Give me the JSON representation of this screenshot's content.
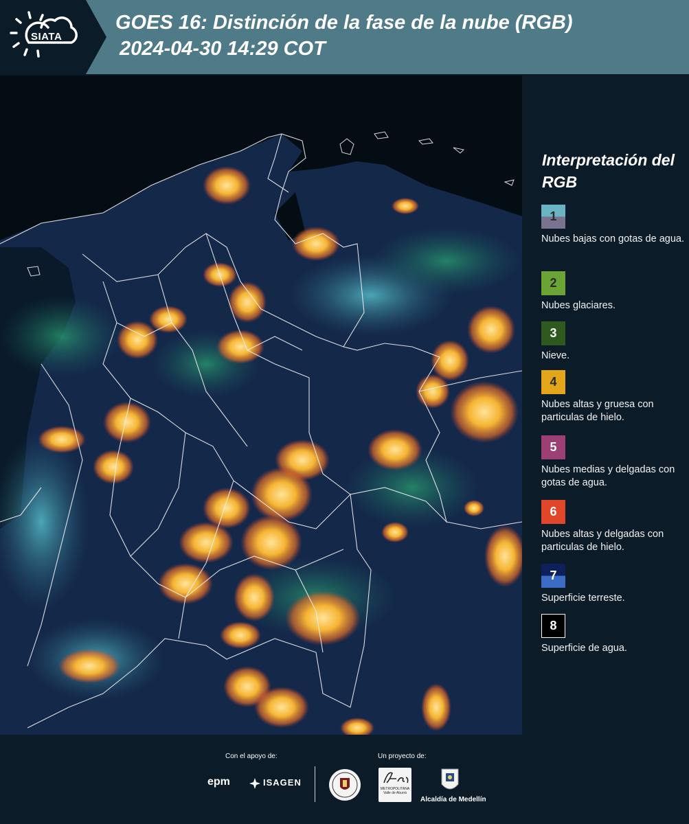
{
  "header": {
    "logo_text": "SIATA",
    "title_line1": "GOES 16: Distinción de la fase de la nube (RGB)",
    "title_line2": "2024-04-30 14:29 COT",
    "background_color": "#4f7a88"
  },
  "legend": {
    "title": "Interpretación del RGB",
    "items": [
      {
        "number": "1",
        "description": "Nubes bajas con gotas de agua.",
        "colors": [
          "#6ab3c2",
          "#7a7390"
        ]
      },
      {
        "number": "2",
        "description": "Nubes glaciares.",
        "colors": [
          "#6aa434"
        ]
      },
      {
        "number": "3",
        "description": "Nieve.",
        "colors": [
          "#2f5a1e"
        ]
      },
      {
        "number": "4",
        "description": "Nubes altas y gruesa con particulas de hielo.",
        "colors": [
          "#e3a61a"
        ]
      },
      {
        "number": "5",
        "description": "Nubes medias y delgadas con gotas de agua.",
        "colors": [
          "#9b3f74"
        ]
      },
      {
        "number": "6",
        "description": "Nubes altas y delgadas con particulas de hielo.",
        "colors": [
          "#e0462a"
        ]
      },
      {
        "number": "7",
        "description": "Superficie terreste.",
        "colors": [
          "#0d1f5c",
          "#3c6cc4"
        ]
      },
      {
        "number": "8",
        "description": "Superficie de agua.",
        "colors": [
          "#000000"
        ]
      }
    ]
  },
  "footer": {
    "support_label": "Con el apoyo de:",
    "project_label": "Un proyecto de:",
    "sponsors": [
      "epm",
      "ISAGEN"
    ],
    "partners": [
      "METROPOLITANA Valle de Aburrá",
      "Alcaldía de Medellín"
    ]
  }
}
